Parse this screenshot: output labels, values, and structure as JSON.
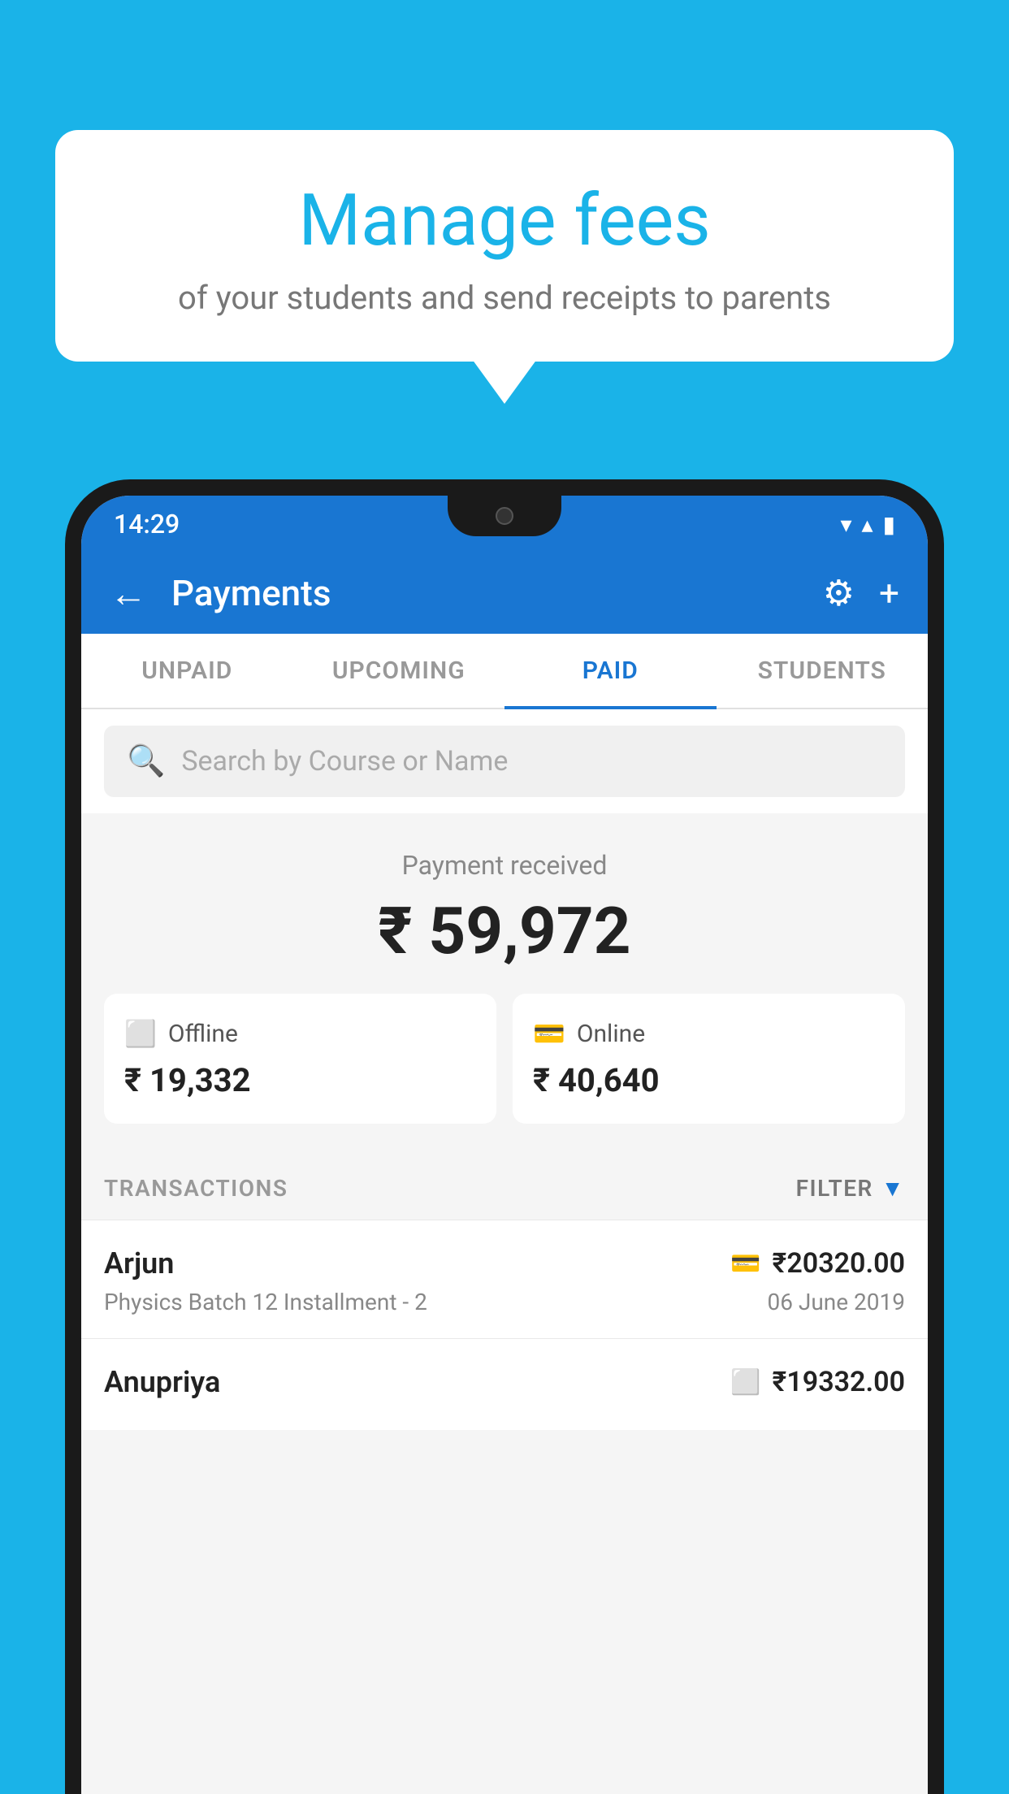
{
  "background_color": "#1ab3e8",
  "bubble": {
    "title": "Manage fees",
    "subtitle": "of your students and send receipts to parents"
  },
  "status_bar": {
    "time": "14:29",
    "wifi_icon": "▼",
    "signal_icon": "▲",
    "battery_icon": "▮"
  },
  "header": {
    "title": "Payments",
    "back_label": "←",
    "settings_label": "⚙",
    "add_label": "+"
  },
  "tabs": [
    {
      "label": "UNPAID",
      "active": false
    },
    {
      "label": "UPCOMING",
      "active": false
    },
    {
      "label": "PAID",
      "active": true
    },
    {
      "label": "STUDENTS",
      "active": false
    }
  ],
  "search": {
    "placeholder": "Search by Course or Name"
  },
  "payment_summary": {
    "label": "Payment received",
    "amount": "₹ 59,972",
    "offline": {
      "label": "Offline",
      "amount": "₹ 19,332",
      "icon": "💳"
    },
    "online": {
      "label": "Online",
      "amount": "₹ 40,640",
      "icon": "💳"
    }
  },
  "transactions": {
    "header_label": "TRANSACTIONS",
    "filter_label": "FILTER",
    "rows": [
      {
        "name": "Arjun",
        "course": "Physics Batch 12 Installment - 2",
        "amount": "₹20320.00",
        "date": "06 June 2019",
        "payment_type": "online"
      },
      {
        "name": "Anupriya",
        "course": "",
        "amount": "₹19332.00",
        "date": "",
        "payment_type": "offline"
      }
    ]
  }
}
